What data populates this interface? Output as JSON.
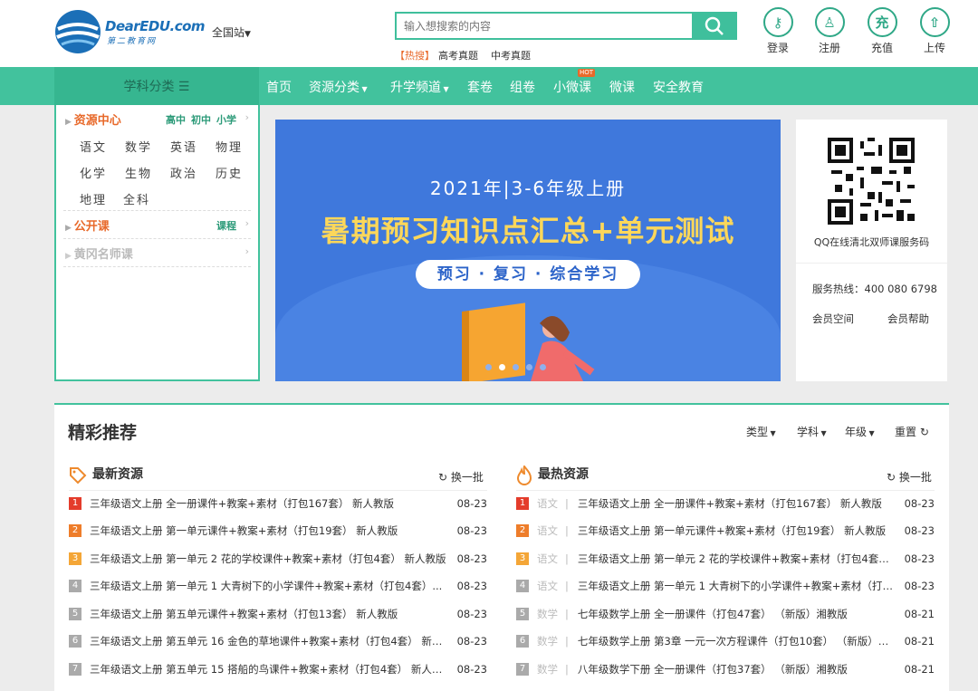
{
  "header": {
    "logo_text": "DearEDU.com",
    "logo_sub": "第二教育网",
    "region": "全国站",
    "search_placeholder": "输入想搜索的内容",
    "hot_tag": "【热搜】",
    "hot_items": [
      "高考真题",
      "中考真题"
    ],
    "user_buttons": [
      {
        "label": "登录",
        "glyph": "⚷"
      },
      {
        "label": "注册",
        "glyph": "♙"
      },
      {
        "label": "充值",
        "glyph": "充"
      },
      {
        "label": "上传",
        "glyph": "⇧"
      }
    ]
  },
  "nav": {
    "category_label": "学科分类 ☰",
    "items": [
      "首页",
      "资源分类",
      "升学频道",
      "套卷",
      "组卷",
      "小微课",
      "微课",
      "安全教育"
    ],
    "hot_badge": "HOT"
  },
  "sidebar": {
    "resource_center": "资源中心",
    "levels": [
      "高中",
      "初中",
      "小学"
    ],
    "subjects": [
      "语文",
      "数学",
      "英语",
      "物理",
      "化学",
      "生物",
      "政治",
      "历史",
      "地理",
      "全科"
    ],
    "open_course": "公开课",
    "open_course_sub": "课程",
    "famous_teacher": "黄冈名师课"
  },
  "banner": {
    "year_line": "2021年|3-6年级上册",
    "main_line": "暑期预习知识点汇总+单元测试",
    "pill": "预习 · 复习 · 综合学习"
  },
  "qr_panel": {
    "caption": "QQ在线清北双师课服务码",
    "hotline": "服务热线：400 080 6798",
    "member_space": "会员空间",
    "member_help": "会员帮助"
  },
  "recommend": {
    "title": "精彩推荐",
    "filters": [
      "类型",
      "学科",
      "年级",
      "重置"
    ],
    "latest": {
      "title": "最新资源",
      "swap": "换一批",
      "items": [
        {
          "n": "1",
          "title": "三年级语文上册 全一册课件+教案+素材（打包167套） 新人教版",
          "date": "08-23"
        },
        {
          "n": "2",
          "title": "三年级语文上册 第一单元课件+教案+素材（打包19套） 新人教版",
          "date": "08-23"
        },
        {
          "n": "3",
          "title": "三年级语文上册 第一单元 2 花的学校课件+教案+素材（打包4套） 新人教版",
          "date": "08-23"
        },
        {
          "n": "4",
          "title": "三年级语文上册 第一单元 1 大青树下的小学课件+教案+素材（打包4套）...",
          "date": "08-23"
        },
        {
          "n": "5",
          "title": "三年级语文上册 第五单元课件+教案+素材（打包13套） 新人教版",
          "date": "08-23"
        },
        {
          "n": "6",
          "title": "三年级语文上册 第五单元 16 金色的草地课件+教案+素材（打包4套） 新人...",
          "date": "08-23"
        },
        {
          "n": "7",
          "title": "三年级语文上册 第五单元 15 搭船的鸟课件+教案+素材（打包4套） 新人教版",
          "date": "08-23"
        }
      ]
    },
    "hottest": {
      "title": "最热资源",
      "swap": "换一批",
      "items": [
        {
          "n": "1",
          "subject": "语文",
          "title": "三年级语文上册 全一册课件+教案+素材（打包167套） 新人教版",
          "date": "08-23"
        },
        {
          "n": "2",
          "subject": "语文",
          "title": "三年级语文上册 第一单元课件+教案+素材（打包19套） 新人教版",
          "date": "08-23"
        },
        {
          "n": "3",
          "subject": "语文",
          "title": "三年级语文上册 第一单元 2 花的学校课件+教案+素材（打包4套） ...",
          "date": "08-23"
        },
        {
          "n": "4",
          "subject": "语文",
          "title": "三年级语文上册 第一单元 1 大青树下的小学课件+教案+素材（打包...",
          "date": "08-23"
        },
        {
          "n": "5",
          "subject": "数学",
          "title": "七年级数学上册 全一册课件（打包47套） （新版）湘教版",
          "date": "08-21"
        },
        {
          "n": "6",
          "subject": "数学",
          "title": "七年级数学上册 第3章 一元一次方程课件（打包10套） （新版）湘...",
          "date": "08-21"
        },
        {
          "n": "7",
          "subject": "数学",
          "title": "八年级数学下册 全一册课件（打包37套） （新版）湘教版",
          "date": "08-21"
        }
      ]
    }
  }
}
